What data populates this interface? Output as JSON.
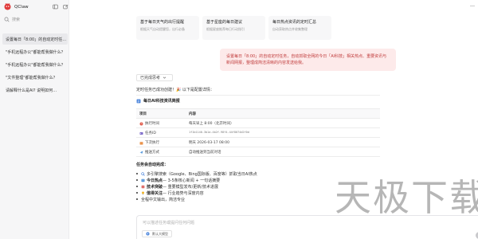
{
  "colors": {
    "accent": "#e03b3b",
    "user_bubble_bg": "#fdeaea",
    "user_bubble_text": "#c03c3c",
    "sidebar_bg": "#f6f6f7"
  },
  "sidebar": {
    "app_name": "QClaw",
    "search_label": "搜索",
    "icons": [
      "panel-toggle-icon",
      "new-chat-icon"
    ],
    "chats": [
      {
        "label": "设置每日「8:00」的自动定时任…",
        "active": true
      },
      {
        "label": "\"手机远程办公\"都能帮我做什么？",
        "active": false
      },
      {
        "label": "\"手机远程办公\"都能帮我做什么？",
        "active": false
      },
      {
        "label": "\"文件整理\"都能帮我做什么？",
        "active": false
      },
      {
        "label": "请解释什么是AI? 说明如何…",
        "active": false
      }
    ]
  },
  "suggestions": [
    {
      "title": "基于每日天气的出行提醒",
      "desc": "根据天气自动提醒您，出行必备"
    },
    {
      "title": "基于星座的每日建议",
      "desc": "根据星座推荐每日行动指引"
    },
    {
      "title": "每日热点资讯的定时汇总",
      "desc": "自动获取热点并收集整理"
    }
  ],
  "user_message": "设置每日「8:00」的自动定时任务，自动抓取全网的今日「AI科技」相关热点、重要资讯与新闻网报，整理成简洁清晰的内容发送给我。",
  "thinking_label": "已完成思考",
  "success_text": "定时任务已成功创建！🎉 以下是配置详情：",
  "task": {
    "title": "每日AI科技资讯简报",
    "headers": [
      "项目",
      "内容"
    ],
    "rows": [
      {
        "icon": "clock-icon",
        "label": "执行时间",
        "value": "每天早上 8:00（北京时间）",
        "mono": false
      },
      {
        "icon": "id-badge-icon",
        "label": "任务ID",
        "value": "1f1b1140-3b1a-4b2f-98f4-44f8074d2f0d",
        "mono": true
      },
      {
        "icon": "calendar-icon",
        "label": "下次执行",
        "value": "明天 2026-03-17 08:00",
        "mono": false
      },
      {
        "icon": "send-icon",
        "label": "推送方式",
        "value": "自动推送到当前对话",
        "mono": false
      }
    ]
  },
  "auto_heading": "任务会自动完成：",
  "bullets": [
    {
      "icon": "search-icon",
      "bold": "",
      "text": "多引擎搜索（Google、Bing国际版、百度等）抓取当日AI热点"
    },
    {
      "icon": "news-icon",
      "bold": "今日热点",
      "text": " — 3-5条核心新闻 + 一句话摘要"
    },
    {
      "icon": "book-icon",
      "bold": "技术突破",
      "text": " — 重要模型发布/更新/技术进展"
    },
    {
      "icon": "lightbulb-icon",
      "bold": "值得关注",
      "text": " — 行业趋势与深度内容"
    },
    {
      "icon": "",
      "bold": "",
      "text": "全程中文输出，简洁专业"
    }
  ],
  "watermark": "天极下载",
  "composer": {
    "placeholder": "可以描述任务或提问任何问题",
    "model_label": "默认大模型"
  }
}
